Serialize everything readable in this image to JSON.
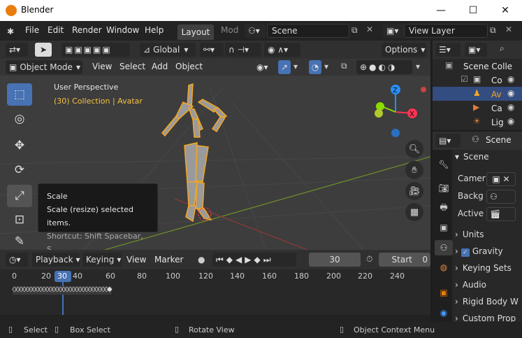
{
  "window": {
    "title": "Blender",
    "minimize": "—",
    "maximize": "☐",
    "close": "✕"
  },
  "menu": {
    "items": [
      "File",
      "Edit",
      "Render",
      "Window",
      "Help"
    ],
    "active_workspace": "Layout",
    "next_workspace": "Mod"
  },
  "scene_selector": {
    "value": "Scene"
  },
  "view_layer_selector": {
    "value": "View Layer"
  },
  "header": {
    "transform_orientation": "Global",
    "options": "Options"
  },
  "viewport_header": {
    "mode": "Object Mode",
    "menus": [
      "View",
      "Select",
      "Add",
      "Object"
    ]
  },
  "viewport": {
    "perspective": "User Perspective",
    "collection": "(30) Collection | Avatar"
  },
  "gizmo": {
    "z": "Z",
    "x": "X"
  },
  "tooltip": {
    "title": "Scale",
    "description": "Scale (resize) selected items.",
    "shortcut": "Shortcut: Shift Spacebar, S"
  },
  "timeline": {
    "menus": [
      "Playback",
      "Keying",
      "View",
      "Marker"
    ],
    "current_frame": "30",
    "start_label": "Start",
    "start_value": "0",
    "ticks": [
      "0",
      "20",
      "30",
      "40",
      "60",
      "80",
      "100",
      "120",
      "140",
      "160",
      "180",
      "200",
      "220",
      "240"
    ]
  },
  "outliner": {
    "items": [
      {
        "label": "Scene Colle"
      },
      {
        "label": "Co"
      },
      {
        "label": "Av"
      },
      {
        "label": "Ca"
      },
      {
        "label": "Lig"
      }
    ]
  },
  "properties": {
    "context": "Scene",
    "panel": "Scene",
    "fields": [
      {
        "label": "Camer"
      },
      {
        "label": "Backg"
      },
      {
        "label": "Active"
      }
    ],
    "sections": [
      "Units",
      "Gravity",
      "Keying Sets",
      "Audio",
      "Rigid Body W",
      "Custom Prop"
    ]
  },
  "statusbar": {
    "select": "Select",
    "box_select": "Box Select",
    "rotate_view": "Rotate View",
    "context_menu": "Object Context Menu"
  },
  "colors": {
    "accent_blue": "#4772b3",
    "selection_orange": "#f5a623",
    "axis_red": "#ff3352",
    "axis_green": "#8bdc00",
    "axis_blue": "#2890ff"
  }
}
